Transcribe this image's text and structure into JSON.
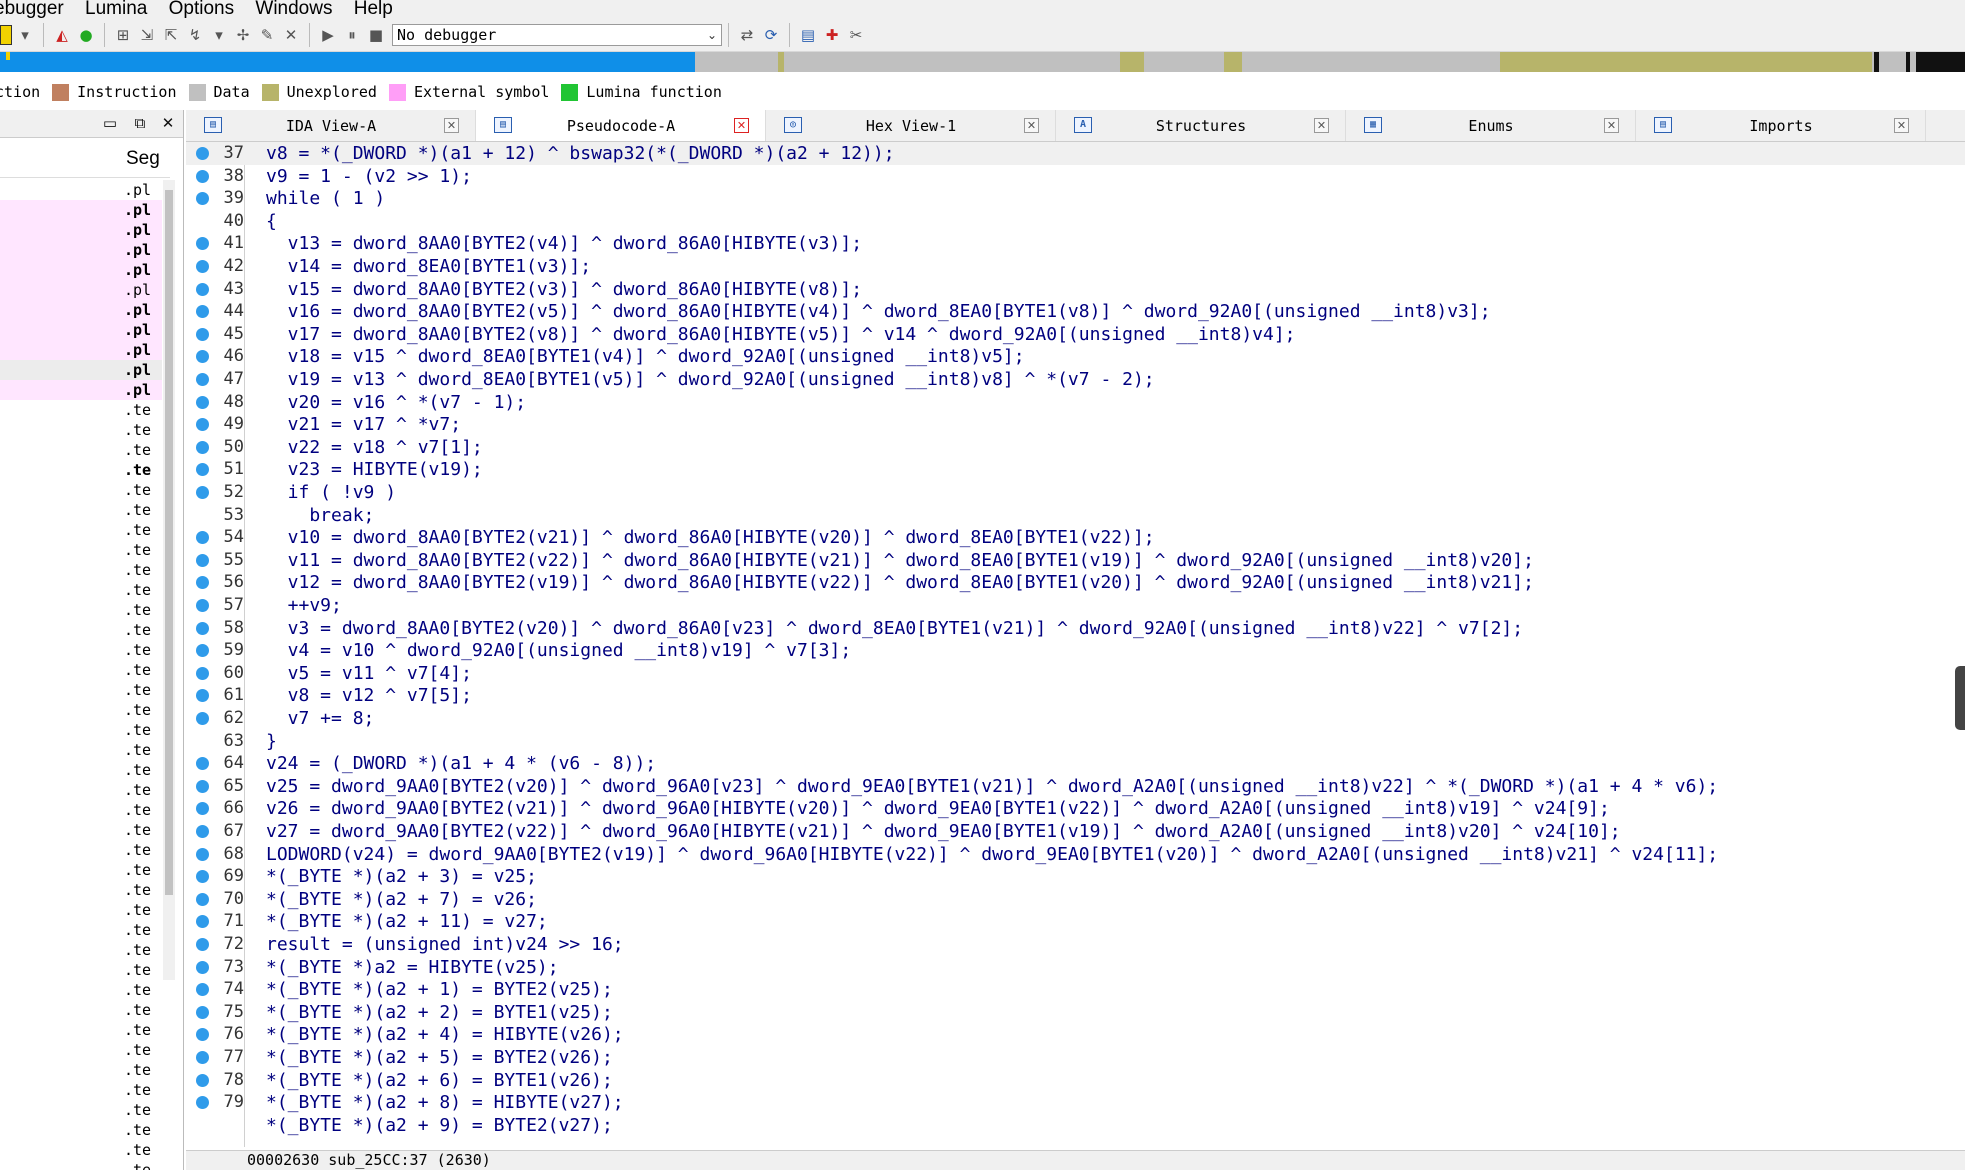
{
  "menu": [
    "ebugger",
    "Lumina",
    "Options",
    "Windows",
    "Help"
  ],
  "toolbar": {
    "debugger_select": "No debugger"
  },
  "legend": [
    {
      "label": "ction",
      "color": "#4c6bd6"
    },
    {
      "label": "Instruction",
      "color": "#c08060"
    },
    {
      "label": "Data",
      "color": "#c0c0c0"
    },
    {
      "label": "Unexplored",
      "color": "#b7b46a"
    },
    {
      "label": "External symbol",
      "color": "#ff9ef7"
    },
    {
      "label": "Lumina function",
      "color": "#21c534"
    }
  ],
  "left_panel": {
    "header": "Seg",
    "items": [
      {
        "text": ".pl",
        "style": "normal"
      },
      {
        "text": ".pl",
        "style": "pink-bold"
      },
      {
        "text": ".pl",
        "style": "pink-bold"
      },
      {
        "text": ".pl",
        "style": "pink-bold"
      },
      {
        "text": ".pl",
        "style": "pink-bold"
      },
      {
        "text": ".pl",
        "style": "pink"
      },
      {
        "text": ".pl",
        "style": "pink-bold"
      },
      {
        "text": ".pl",
        "style": "pink-bold"
      },
      {
        "text": ".pl",
        "style": "pink-bold"
      },
      {
        "text": ".pl",
        "style": "sel-bold"
      },
      {
        "text": ".pl",
        "style": "pink-bold"
      },
      {
        "text": ".te",
        "style": "normal"
      },
      {
        "text": ".te",
        "style": "normal"
      },
      {
        "text": ".te",
        "style": "normal"
      },
      {
        "text": ".te",
        "style": "bold"
      },
      {
        "text": ".te",
        "style": "normal"
      },
      {
        "text": ".te",
        "style": "normal"
      },
      {
        "text": ".te",
        "style": "normal"
      },
      {
        "text": ".te",
        "style": "normal"
      },
      {
        "text": ".te",
        "style": "normal"
      },
      {
        "text": ".te",
        "style": "normal"
      },
      {
        "text": ".te",
        "style": "normal"
      },
      {
        "text": ".te",
        "style": "normal"
      },
      {
        "text": ".te",
        "style": "normal"
      },
      {
        "text": ".te",
        "style": "normal"
      },
      {
        "text": ".te",
        "style": "normal"
      },
      {
        "text": ".te",
        "style": "normal"
      },
      {
        "text": ".te",
        "style": "normal"
      },
      {
        "text": ".te",
        "style": "normal"
      },
      {
        "text": ".te",
        "style": "normal"
      },
      {
        "text": ".te",
        "style": "normal"
      },
      {
        "text": ".te",
        "style": "normal"
      },
      {
        "text": ".te",
        "style": "normal"
      },
      {
        "text": ".te",
        "style": "normal"
      },
      {
        "text": ".te",
        "style": "normal"
      },
      {
        "text": ".te",
        "style": "normal"
      },
      {
        "text": ".te",
        "style": "normal"
      },
      {
        "text": ".te",
        "style": "normal"
      },
      {
        "text": ".te",
        "style": "normal"
      },
      {
        "text": ".te",
        "style": "normal"
      },
      {
        "text": ".te",
        "style": "normal"
      },
      {
        "text": ".te",
        "style": "normal"
      },
      {
        "text": ".te",
        "style": "normal"
      },
      {
        "text": ".te",
        "style": "normal"
      },
      {
        "text": ".te",
        "style": "normal"
      },
      {
        "text": ".te",
        "style": "normal"
      },
      {
        "text": ".te",
        "style": "normal"
      },
      {
        "text": ".te",
        "style": "normal"
      },
      {
        "text": ".te",
        "style": "normal"
      },
      {
        "text": ".te",
        "style": "normal"
      },
      {
        "text": ".te",
        "style": "normal"
      },
      {
        "text": ".te",
        "style": "normal"
      }
    ]
  },
  "tabs": [
    {
      "label": "IDA View-A",
      "icon": "ida-view-icon",
      "glyph": "▤",
      "active": false
    },
    {
      "label": "Pseudocode-A",
      "icon": "pseudocode-icon",
      "glyph": "▤",
      "active": true
    },
    {
      "label": "Hex View-1",
      "icon": "hex-view-icon",
      "glyph": "◎",
      "active": false
    },
    {
      "label": "Structures",
      "icon": "structures-icon",
      "glyph": "A",
      "active": false
    },
    {
      "label": "Enums",
      "icon": "enums-icon",
      "glyph": "▦",
      "active": false
    },
    {
      "label": "Imports",
      "icon": "imports-icon",
      "glyph": "▤",
      "active": false
    }
  ],
  "code_lines": [
    {
      "num": "37",
      "text": "v8 = *(_DWORD *)(a1 + 12) ^ bswap32(*(_DWORD *)(a2 + 12));",
      "dot": true,
      "current": true
    },
    {
      "num": "38",
      "text": "v9 = 1 - (v2 >> 1);",
      "dot": true
    },
    {
      "num": "39",
      "text": "while ( 1 )",
      "dot": true
    },
    {
      "num": "40",
      "text": "{",
      "dot": false
    },
    {
      "num": "41",
      "text": "  v13 = dword_8AA0[BYTE2(v4)] ^ dword_86A0[HIBYTE(v3)];",
      "dot": true
    },
    {
      "num": "42",
      "text": "  v14 = dword_8EA0[BYTE1(v3)];",
      "dot": true
    },
    {
      "num": "43",
      "text": "  v15 = dword_8AA0[BYTE2(v3)] ^ dword_86A0[HIBYTE(v8)];",
      "dot": true
    },
    {
      "num": "44",
      "text": "  v16 = dword_8AA0[BYTE2(v5)] ^ dword_86A0[HIBYTE(v4)] ^ dword_8EA0[BYTE1(v8)] ^ dword_92A0[(unsigned __int8)v3];",
      "dot": true
    },
    {
      "num": "45",
      "text": "  v17 = dword_8AA0[BYTE2(v8)] ^ dword_86A0[HIBYTE(v5)] ^ v14 ^ dword_92A0[(unsigned __int8)v4];",
      "dot": true
    },
    {
      "num": "46",
      "text": "  v18 = v15 ^ dword_8EA0[BYTE1(v4)] ^ dword_92A0[(unsigned __int8)v5];",
      "dot": true
    },
    {
      "num": "47",
      "text": "  v19 = v13 ^ dword_8EA0[BYTE1(v5)] ^ dword_92A0[(unsigned __int8)v8] ^ *(v7 - 2);",
      "dot": true
    },
    {
      "num": "48",
      "text": "  v20 = v16 ^ *(v7 - 1);",
      "dot": true
    },
    {
      "num": "49",
      "text": "  v21 = v17 ^ *v7;",
      "dot": true
    },
    {
      "num": "50",
      "text": "  v22 = v18 ^ v7[1];",
      "dot": true
    },
    {
      "num": "51",
      "text": "  v23 = HIBYTE(v19);",
      "dot": true
    },
    {
      "num": "52",
      "text": "  if ( !v9 )",
      "dot": true
    },
    {
      "num": "53",
      "text": "    break;",
      "dot": false
    },
    {
      "num": "54",
      "text": "  v10 = dword_8AA0[BYTE2(v21)] ^ dword_86A0[HIBYTE(v20)] ^ dword_8EA0[BYTE1(v22)];",
      "dot": true
    },
    {
      "num": "55",
      "text": "  v11 = dword_8AA0[BYTE2(v22)] ^ dword_86A0[HIBYTE(v21)] ^ dword_8EA0[BYTE1(v19)] ^ dword_92A0[(unsigned __int8)v20];",
      "dot": true
    },
    {
      "num": "56",
      "text": "  v12 = dword_8AA0[BYTE2(v19)] ^ dword_86A0[HIBYTE(v22)] ^ dword_8EA0[BYTE1(v20)] ^ dword_92A0[(unsigned __int8)v21];",
      "dot": true
    },
    {
      "num": "57",
      "text": "  ++v9;",
      "dot": true
    },
    {
      "num": "58",
      "text": "  v3 = dword_8AA0[BYTE2(v20)] ^ dword_86A0[v23] ^ dword_8EA0[BYTE1(v21)] ^ dword_92A0[(unsigned __int8)v22] ^ v7[2];",
      "dot": true
    },
    {
      "num": "59",
      "text": "  v4 = v10 ^ dword_92A0[(unsigned __int8)v19] ^ v7[3];",
      "dot": true
    },
    {
      "num": "60",
      "text": "  v5 = v11 ^ v7[4];",
      "dot": true
    },
    {
      "num": "61",
      "text": "  v8 = v12 ^ v7[5];",
      "dot": true
    },
    {
      "num": "62",
      "text": "  v7 += 8;",
      "dot": true
    },
    {
      "num": "63",
      "text": "}",
      "dot": false
    },
    {
      "num": "64",
      "text": "v24 = (_DWORD *)(a1 + 4 * (v6 - 8));",
      "dot": true
    },
    {
      "num": "65",
      "text": "v25 = dword_9AA0[BYTE2(v20)] ^ dword_96A0[v23] ^ dword_9EA0[BYTE1(v21)] ^ dword_A2A0[(unsigned __int8)v22] ^ *(_DWORD *)(a1 + 4 * v6);",
      "dot": true
    },
    {
      "num": "66",
      "text": "v26 = dword_9AA0[BYTE2(v21)] ^ dword_96A0[HIBYTE(v20)] ^ dword_9EA0[BYTE1(v22)] ^ dword_A2A0[(unsigned __int8)v19] ^ v24[9];",
      "dot": true
    },
    {
      "num": "67",
      "text": "v27 = dword_9AA0[BYTE2(v22)] ^ dword_96A0[HIBYTE(v21)] ^ dword_9EA0[BYTE1(v19)] ^ dword_A2A0[(unsigned __int8)v20] ^ v24[10];",
      "dot": true
    },
    {
      "num": "68",
      "text": "LODWORD(v24) = dword_9AA0[BYTE2(v19)] ^ dword_96A0[HIBYTE(v22)] ^ dword_9EA0[BYTE1(v20)] ^ dword_A2A0[(unsigned __int8)v21] ^ v24[11];",
      "dot": true
    },
    {
      "num": "69",
      "text": "*(_BYTE *)(a2 + 3) = v25;",
      "dot": true
    },
    {
      "num": "70",
      "text": "*(_BYTE *)(a2 + 7) = v26;",
      "dot": true
    },
    {
      "num": "71",
      "text": "*(_BYTE *)(a2 + 11) = v27;",
      "dot": true
    },
    {
      "num": "72",
      "text": "result = (unsigned int)v24 >> 16;",
      "dot": true
    },
    {
      "num": "73",
      "text": "*(_BYTE *)a2 = HIBYTE(v25);",
      "dot": true
    },
    {
      "num": "74",
      "text": "*(_BYTE *)(a2 + 1) = BYTE2(v25);",
      "dot": true
    },
    {
      "num": "75",
      "text": "*(_BYTE *)(a2 + 2) = BYTE1(v25);",
      "dot": true
    },
    {
      "num": "76",
      "text": "*(_BYTE *)(a2 + 4) = HIBYTE(v26);",
      "dot": true
    },
    {
      "num": "77",
      "text": "*(_BYTE *)(a2 + 5) = BYTE2(v26);",
      "dot": true
    },
    {
      "num": "78",
      "text": "*(_BYTE *)(a2 + 6) = BYTE1(v26);",
      "dot": true
    },
    {
      "num": "79",
      "text": "*(_BYTE *)(a2 + 8) = HIBYTE(v27);",
      "dot": true
    },
    {
      "num": "",
      "text": "*(_BYTE *)(a2 + 9) = BYTE2(v27);",
      "dot": false
    }
  ],
  "status": "00002630 sub_25CC:37 (2630)"
}
